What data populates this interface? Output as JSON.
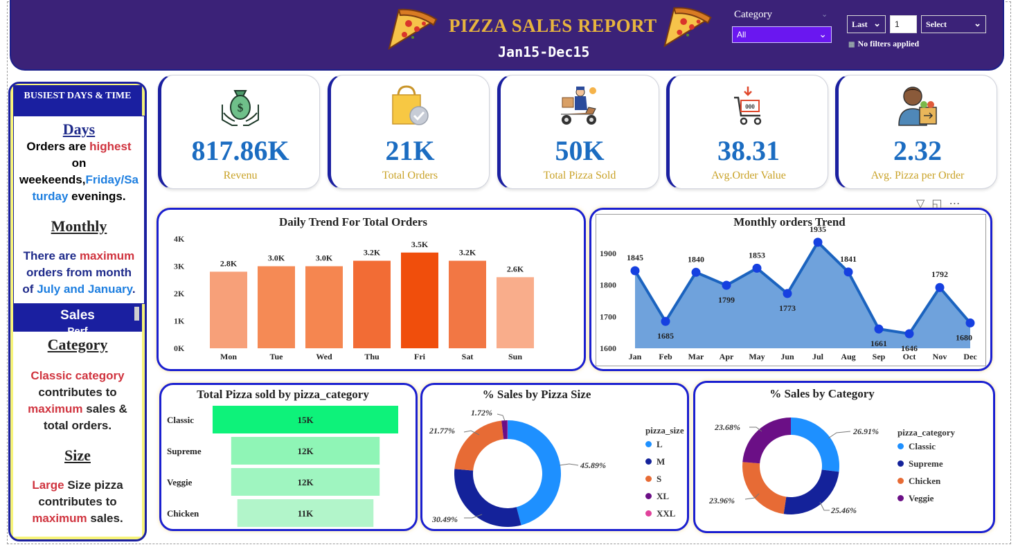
{
  "header": {
    "title": "PIZZA SALES REPORT",
    "subtitle": "Jan15-Dec15",
    "category_filter_label": "Category",
    "category_filter_value": "All",
    "relative_period": "Last",
    "relative_count": "1",
    "relative_unit": "Select",
    "filter_status": "No filters applied"
  },
  "sidebar": {
    "heading": "BUSIEST DAYS & TIME",
    "days_heading": "Days",
    "days_text_1": "Orders are ",
    "days_text_2": "highest",
    "days_text_3": "on",
    "days_text_4": "weekeends,",
    "days_text_5": "Friday/Sa",
    "days_text_6": "turday",
    "days_text_7": " evenings.",
    "monthly_heading": "Monthly",
    "monthly_text_1": "There are ",
    "monthly_text_2": "maximum",
    "monthly_text_3": "orders from month",
    "monthly_text_4": "of ",
    "monthly_text_5": "July and January",
    "monthly_text_6": ".",
    "sales_heading": "Sales",
    "sales_heading_cut": "Perf",
    "category_heading": "Category ",
    "category_text_1": "Classic category",
    "category_text_2": "contributes to",
    "category_text_3": "maximum",
    "category_text_4": " sales &",
    "category_text_5": "total orders.",
    "size_heading": "Size",
    "size_text_1": "Large",
    "size_text_2": " Size pizza",
    "size_text_3": "contributes  to",
    "size_text_4": "maximum",
    "size_text_5": " sales."
  },
  "kpis": [
    {
      "value": "817.86K",
      "label": "Revenu",
      "icon": "money-bag-hands-icon"
    },
    {
      "value": "21K",
      "label": "Total Orders",
      "icon": "shopping-bag-check-icon"
    },
    {
      "value": "50K",
      "label": "Total Pizza Sold",
      "icon": "delivery-scooter-icon"
    },
    {
      "value": "38.31",
      "label": "Avg.Order Value",
      "icon": "shopping-cart-icon"
    },
    {
      "value": "2.32",
      "label": "Avg. Pizza per Order",
      "icon": "person-with-bag-icon"
    }
  ],
  "colors": {
    "header_bg": "#3b2278",
    "title": "#e7b43e",
    "kpi_value": "#1b6cc1",
    "kpi_label": "#c9a227",
    "panel_border": "#1a1fd0"
  },
  "chart_data": [
    {
      "type": "bar",
      "title": "Daily Trend For Total Orders",
      "categories": [
        "Mon",
        "Tue",
        "Wed",
        "Thu",
        "Fri",
        "Sat",
        "Sun"
      ],
      "values": [
        2.8,
        3.0,
        3.0,
        3.2,
        3.5,
        3.2,
        2.6
      ],
      "data_labels": [
        "2.8K",
        "3.0K",
        "3.0K",
        "3.2K",
        "3.5K",
        "3.2K",
        "2.6K"
      ],
      "yticks": [
        "0K",
        "1K",
        "2K",
        "3K",
        "4K"
      ],
      "ylim": [
        0,
        4
      ],
      "colors": [
        "#f7a079",
        "#f58a55",
        "#f58650",
        "#f26c35",
        "#f04e0c",
        "#f27744",
        "#f9ad8b"
      ]
    },
    {
      "type": "area",
      "title": "Monthly orders Trend",
      "categories": [
        "Jan",
        "Feb",
        "Mar",
        "Apr",
        "May",
        "Jun",
        "Jul",
        "Aug",
        "Sep",
        "Oct",
        "Nov",
        "Dec"
      ],
      "values": [
        1845,
        1685,
        1840,
        1799,
        1853,
        1773,
        1935,
        1841,
        1661,
        1646,
        1792,
        1680
      ],
      "yticks": [
        1600,
        1700,
        1800,
        1900
      ],
      "ylim": [
        1600,
        1950
      ]
    },
    {
      "type": "bar",
      "orientation": "horizontal",
      "title": "Total Pizza sold by pizza_category",
      "categories": [
        "Classic",
        "Supreme",
        "Veggie",
        "Chicken"
      ],
      "values": [
        15,
        12,
        12,
        11
      ],
      "data_labels": [
        "15K",
        "12K",
        "12K",
        "11K"
      ],
      "colors": [
        "#0ef27a",
        "#8ff5b6",
        "#9ff5c0",
        "#b2f5ca"
      ]
    },
    {
      "type": "pie",
      "title": "% Sales by Pizza Size",
      "legend_title": "pizza_size",
      "labels": [
        "L",
        "M",
        "S",
        "XL",
        "XXL"
      ],
      "values": [
        45.89,
        30.49,
        21.77,
        1.72,
        0.12
      ],
      "data_labels": [
        "45.89%",
        "30.49%",
        "21.77%",
        "1.72%",
        ""
      ],
      "colors": [
        "#1e90ff",
        "#14229a",
        "#e76b35",
        "#6b0f86",
        "#e0429b"
      ]
    },
    {
      "type": "pie",
      "title": "% Sales by Category",
      "legend_title": "pizza_category",
      "labels": [
        "Classic",
        "Supreme",
        "Chicken",
        "Veggie"
      ],
      "values": [
        26.91,
        25.46,
        23.96,
        23.68
      ],
      "data_labels": [
        "26.91%",
        "25.46%",
        "23.96%",
        "23.68%"
      ],
      "colors": [
        "#1e90ff",
        "#14229a",
        "#e76b35",
        "#6b0f86"
      ]
    }
  ]
}
